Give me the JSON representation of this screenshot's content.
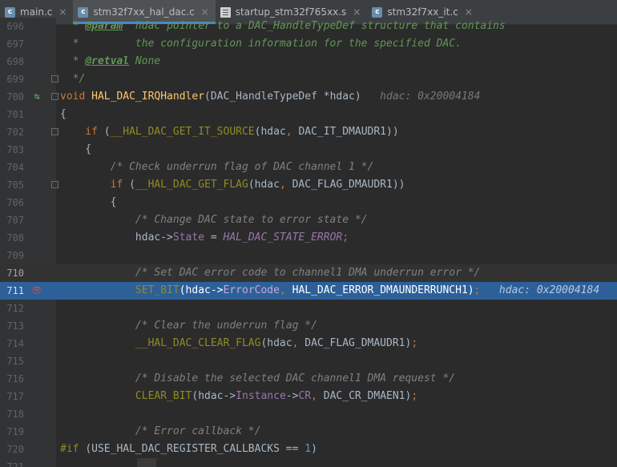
{
  "tabs": [
    {
      "label": "main.c",
      "icon": "c-file-icon",
      "active": false
    },
    {
      "label": "stm32f7xx_hal_dac.c",
      "icon": "c-file-icon",
      "active": true
    },
    {
      "label": "startup_stm32f765xx.s",
      "icon": "asm-file-icon",
      "active": false
    },
    {
      "label": "stm32f7xx_it.c",
      "icon": "c-file-icon",
      "active": false
    }
  ],
  "tab_close_glyph": "×",
  "icon_letter_c": "c",
  "lines": [
    {
      "num": "696",
      "tokens": [
        [
          "doc",
          "  * "
        ],
        [
          "tag",
          "@param"
        ],
        [
          "doc",
          "  hdac pointer to a DAC_HandleTypeDef structure that contains"
        ]
      ]
    },
    {
      "num": "697",
      "tokens": [
        [
          "doc",
          "  *         the configuration information for the specified DAC."
        ]
      ]
    },
    {
      "num": "698",
      "tokens": [
        [
          "doc",
          "  * "
        ],
        [
          "tag",
          "@retval"
        ],
        [
          "doc",
          " None"
        ]
      ]
    },
    {
      "num": "699",
      "fold": true,
      "tokens": [
        [
          "doc",
          "  */"
        ]
      ]
    },
    {
      "num": "700",
      "fold": true,
      "marker": "↹",
      "tokens": [
        [
          "kw",
          "void "
        ],
        [
          "fn",
          "HAL_DAC_IRQHandler"
        ],
        [
          "pl",
          "(DAC_HandleTypeDef *hdac)"
        ],
        [
          "inl",
          "   hdac: 0x20004184"
        ]
      ]
    },
    {
      "num": "701",
      "tokens": [
        [
          "pl",
          "{"
        ]
      ]
    },
    {
      "num": "702",
      "fold": true,
      "tokens": [
        [
          "kw",
          "    if "
        ],
        [
          "pl",
          "("
        ],
        [
          "mac",
          "__HAL_DAC_GET_IT_SOURCE"
        ],
        [
          "pl",
          "(hdac"
        ],
        [
          "kw",
          ", "
        ],
        [
          "pl",
          "DAC_IT_DMAUDR1))"
        ]
      ]
    },
    {
      "num": "703",
      "tokens": [
        [
          "pl",
          "    {"
        ]
      ]
    },
    {
      "num": "704",
      "tokens": [
        [
          "cm",
          "        /* Check underrun flag of DAC channel 1 */"
        ]
      ]
    },
    {
      "num": "705",
      "fold": true,
      "tokens": [
        [
          "kw",
          "        if "
        ],
        [
          "pl",
          "("
        ],
        [
          "mac",
          "__HAL_DAC_GET_FLAG"
        ],
        [
          "pl",
          "(hdac"
        ],
        [
          "kw",
          ", "
        ],
        [
          "pl",
          "DAC_FLAG_DMAUDR1))"
        ]
      ]
    },
    {
      "num": "706",
      "tokens": [
        [
          "pl",
          "        {"
        ]
      ]
    },
    {
      "num": "707",
      "tokens": [
        [
          "cm",
          "            /* Change DAC state to error state */"
        ]
      ]
    },
    {
      "num": "708",
      "tokens": [
        [
          "pl",
          "            hdac->"
        ],
        [
          "fld",
          "State"
        ],
        [
          "pl",
          " = "
        ],
        [
          "enum",
          "HAL_DAC_STATE_ERROR"
        ],
        [
          "kw",
          ";"
        ]
      ]
    },
    {
      "num": "709",
      "tokens": []
    },
    {
      "num": "710",
      "caret": true,
      "tokens": [
        [
          "cm",
          "            /* Set DAC error code to channel1 DMA underrun error */"
        ]
      ]
    },
    {
      "num": "711",
      "exec": true,
      "marker": "👁",
      "tokens": [
        [
          "mac",
          "            SET_BIT"
        ],
        [
          "pl",
          "(hdac->"
        ],
        [
          "fld",
          "ErrorCode"
        ],
        [
          "kw",
          ", "
        ],
        [
          "pl",
          "HAL_DAC_ERROR_DMAUNDERRUNCH1)"
        ],
        [
          "kw",
          ";"
        ],
        [
          "inl",
          "   hdac: 0x20004184"
        ]
      ]
    },
    {
      "num": "712",
      "tokens": []
    },
    {
      "num": "713",
      "tokens": [
        [
          "cm",
          "            /* Clear the underrun flag */"
        ]
      ]
    },
    {
      "num": "714",
      "tokens": [
        [
          "mac",
          "            __HAL_DAC_CLEAR_FLAG"
        ],
        [
          "pl",
          "(hdac"
        ],
        [
          "kw",
          ", "
        ],
        [
          "pl",
          "DAC_FLAG_DMAUDR1)"
        ],
        [
          "kw",
          ";"
        ]
      ]
    },
    {
      "num": "715",
      "tokens": []
    },
    {
      "num": "716",
      "tokens": [
        [
          "cm",
          "            /* Disable the selected DAC channel1 DMA request */"
        ]
      ]
    },
    {
      "num": "717",
      "tokens": [
        [
          "mac",
          "            CLEAR_BIT"
        ],
        [
          "pl",
          "(hdac->"
        ],
        [
          "fld",
          "Instance"
        ],
        [
          "pl",
          "->"
        ],
        [
          "fld",
          "CR"
        ],
        [
          "kw",
          ", "
        ],
        [
          "pl",
          "DAC_CR_DMAEN1)"
        ],
        [
          "kw",
          ";"
        ]
      ]
    },
    {
      "num": "718",
      "tokens": []
    },
    {
      "num": "719",
      "tokens": [
        [
          "cm",
          "            /* Error callback */"
        ]
      ]
    },
    {
      "num": "720",
      "tokens": [
        [
          "mac",
          "#if "
        ],
        [
          "pl",
          "(USE_HAL_DAC_REGISTER_CALLBACKS == "
        ],
        [
          "num",
          "1"
        ],
        [
          "pl",
          ")"
        ]
      ]
    },
    {
      "num": "721",
      "tokens": []
    }
  ],
  "colors": {
    "editor_bg": "#2b2b2b",
    "gutter_bg": "#313335",
    "execution_line": "#2d6099",
    "tab_underline": "#4a88c7",
    "breakpoint": "#c75450"
  }
}
